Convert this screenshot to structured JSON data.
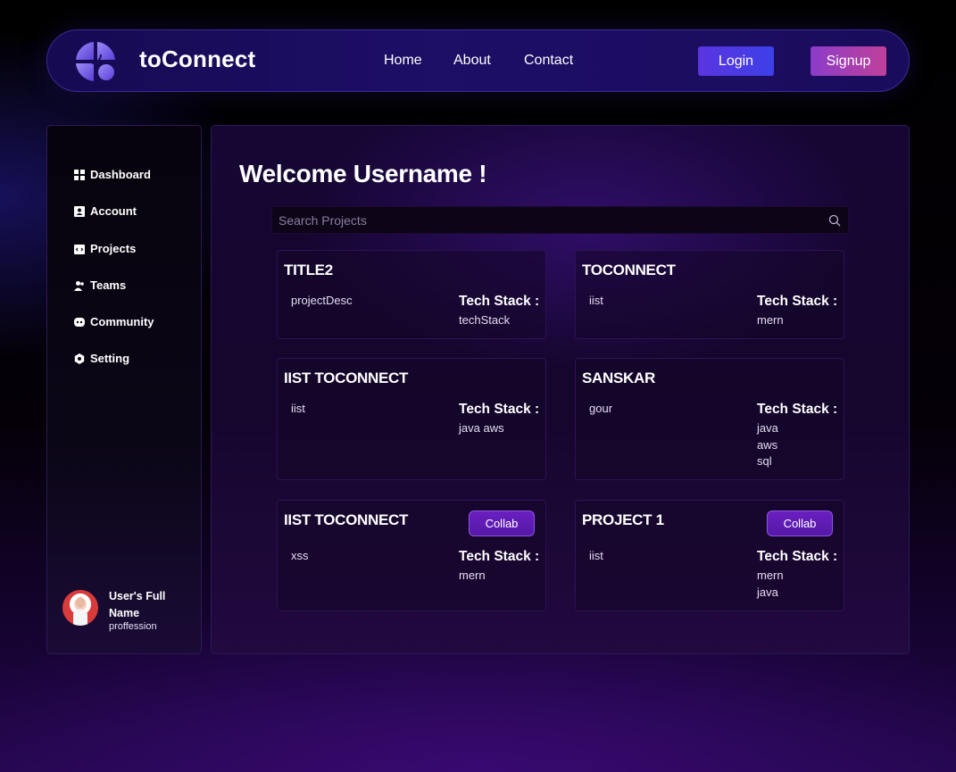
{
  "brand": {
    "name": "toConnect",
    "logo_icon": "logo-icon"
  },
  "nav": {
    "links": [
      "Home",
      "About",
      "Contact"
    ],
    "login": "Login",
    "signup": "Signup"
  },
  "sidebar": {
    "items": [
      {
        "label": "Dashboard",
        "icon": "dashboard-icon"
      },
      {
        "label": "Account",
        "icon": "account-icon"
      },
      {
        "label": "Projects",
        "icon": "projects-icon"
      },
      {
        "label": "Teams",
        "icon": "teams-icon"
      },
      {
        "label": "Community",
        "icon": "community-icon"
      },
      {
        "label": "Setting",
        "icon": "setting-icon"
      }
    ],
    "profile": {
      "name": "User's Full Name",
      "role": "proffession"
    }
  },
  "main": {
    "welcome": "Welcome Username !",
    "search_placeholder": "Search Projects",
    "stack_label": "Tech Stack :",
    "collab_label": "Collab",
    "projects": [
      {
        "title": "TITLE2",
        "desc": "projectDesc",
        "stack": [
          "techStack"
        ]
      },
      {
        "title": "TOCONNECT",
        "desc": "iist",
        "stack": [
          "mern"
        ]
      },
      {
        "title": "IIST TOCONNECT",
        "desc": "iist",
        "stack": [
          "java aws"
        ]
      },
      {
        "title": "SANSKAR",
        "desc": "gour",
        "stack": [
          "java",
          "aws",
          "sql"
        ]
      },
      {
        "title": "IIST TOCONNECT",
        "desc": "xss",
        "stack": [
          "mern"
        ]
      },
      {
        "title": "PROJECT 1",
        "desc": "iist",
        "stack": [
          "mern",
          "java"
        ]
      }
    ]
  },
  "colors": {
    "accent": "#5a35e0",
    "signup": "#c0409a",
    "collab": "#6a1fc0",
    "background": "#000000"
  }
}
